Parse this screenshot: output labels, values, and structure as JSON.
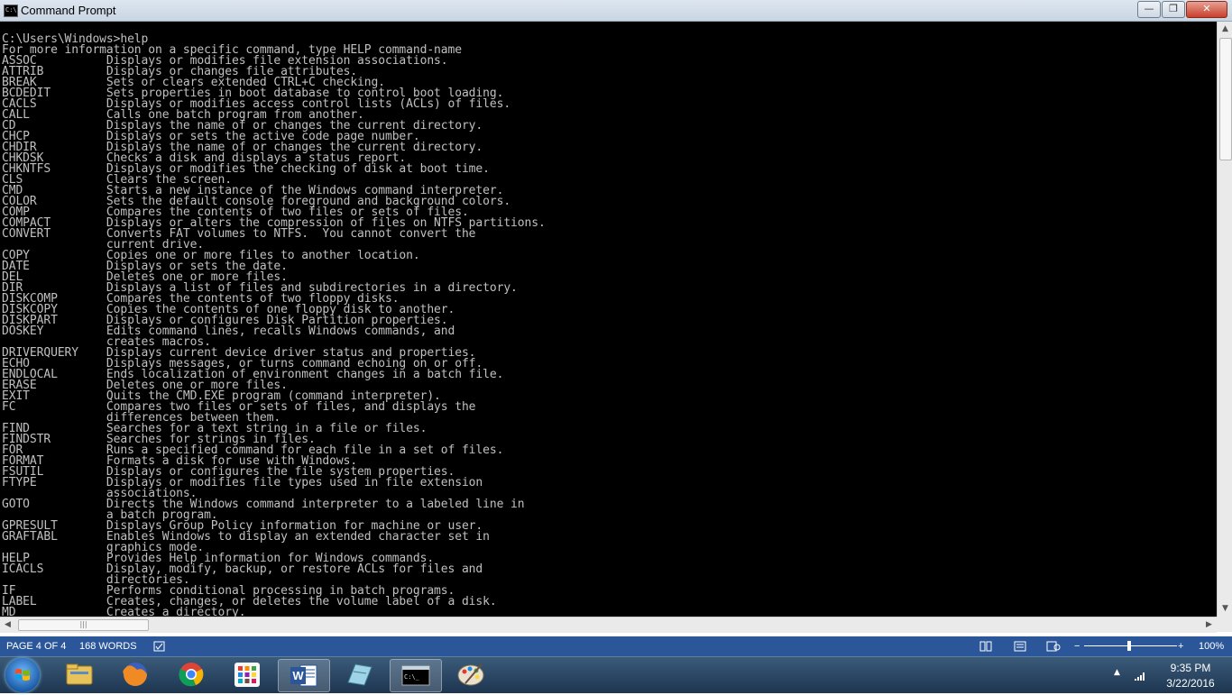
{
  "window": {
    "title": "Command Prompt"
  },
  "console": {
    "lines": [
      "C:\\Users\\Windows>help",
      "For more information on a specific command, type HELP command-name",
      "ASSOC          Displays or modifies file extension associations.",
      "ATTRIB         Displays or changes file attributes.",
      "BREAK          Sets or clears extended CTRL+C checking.",
      "BCDEDIT        Sets properties in boot database to control boot loading.",
      "CACLS          Displays or modifies access control lists (ACLs) of files.",
      "CALL           Calls one batch program from another.",
      "CD             Displays the name of or changes the current directory.",
      "CHCP           Displays or sets the active code page number.",
      "CHDIR          Displays the name of or changes the current directory.",
      "CHKDSK         Checks a disk and displays a status report.",
      "CHKNTFS        Displays or modifies the checking of disk at boot time.",
      "CLS            Clears the screen.",
      "CMD            Starts a new instance of the Windows command interpreter.",
      "COLOR          Sets the default console foreground and background colors.",
      "COMP           Compares the contents of two files or sets of files.",
      "COMPACT        Displays or alters the compression of files on NTFS partitions.",
      "CONVERT        Converts FAT volumes to NTFS.  You cannot convert the",
      "               current drive.",
      "COPY           Copies one or more files to another location.",
      "DATE           Displays or sets the date.",
      "DEL            Deletes one or more files.",
      "DIR            Displays a list of files and subdirectories in a directory.",
      "DISKCOMP       Compares the contents of two floppy disks.",
      "DISKCOPY       Copies the contents of one floppy disk to another.",
      "DISKPART       Displays or configures Disk Partition properties.",
      "DOSKEY         Edits command lines, recalls Windows commands, and",
      "               creates macros.",
      "DRIVERQUERY    Displays current device driver status and properties.",
      "ECHO           Displays messages, or turns command echoing on or off.",
      "ENDLOCAL       Ends localization of environment changes in a batch file.",
      "ERASE          Deletes one or more files.",
      "EXIT           Quits the CMD.EXE program (command interpreter).",
      "FC             Compares two files or sets of files, and displays the",
      "               differences between them.",
      "FIND           Searches for a text string in a file or files.",
      "FINDSTR        Searches for strings in files.",
      "FOR            Runs a specified command for each file in a set of files.",
      "FORMAT         Formats a disk for use with Windows.",
      "FSUTIL         Displays or configures the file system properties.",
      "FTYPE          Displays or modifies file types used in file extension",
      "               associations.",
      "GOTO           Directs the Windows command interpreter to a labeled line in",
      "               a batch program.",
      "GPRESULT       Displays Group Policy information for machine or user.",
      "GRAFTABL       Enables Windows to display an extended character set in",
      "               graphics mode.",
      "HELP           Provides Help information for Windows commands.",
      "ICACLS         Display, modify, backup, or restore ACLs for files and",
      "               directories.",
      "IF             Performs conditional processing in batch programs.",
      "LABEL          Creates, changes, or deletes the volume label of a disk.",
      "MD             Creates a directory."
    ]
  },
  "statusbar": {
    "page": "PAGE 4 OF 4",
    "words": "168 WORDS",
    "zoom": "100%",
    "zoom_minus": "−",
    "zoom_plus": "+"
  },
  "clock": {
    "time": "9:35 PM",
    "date": "3/22/2016"
  },
  "colors": {
    "console_bg": "#000000",
    "console_fg": "#c0c0c0",
    "statusbar_bg": "#2b579a"
  },
  "taskbar_items": [
    "start-orb",
    "file-explorer-icon",
    "firefox-icon",
    "chrome-icon",
    "app-grid-icon",
    "word-icon",
    "notepad-icon",
    "command-prompt-icon",
    "paint-icon"
  ]
}
